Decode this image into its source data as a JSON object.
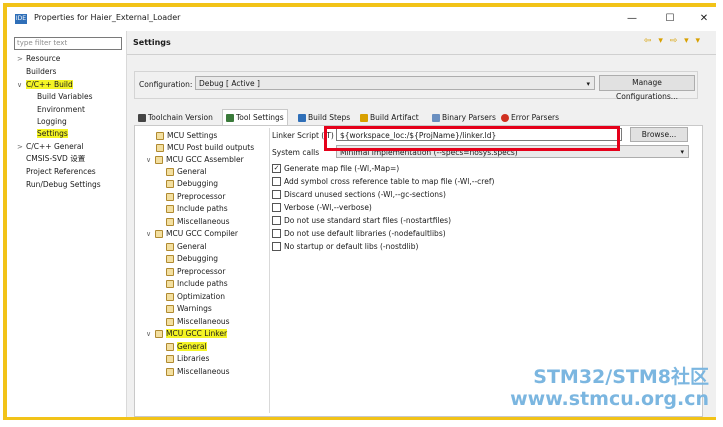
{
  "window": {
    "title": "Properties for Haier_External_Loader",
    "app_icon": "IDE",
    "minimize": "—",
    "maximize": "☐",
    "close": "✕"
  },
  "left": {
    "filter_placeholder": "type filter text",
    "items": [
      {
        "label": "Resource",
        "arrow": ">"
      },
      {
        "label": "Builders",
        "arrow": ""
      },
      {
        "label": "C/C++ Build",
        "arrow": "∨"
      },
      {
        "label": "Build Variables",
        "arrow": ""
      },
      {
        "label": "Environment",
        "arrow": ""
      },
      {
        "label": "Logging",
        "arrow": ""
      },
      {
        "label": "Settings",
        "arrow": ""
      },
      {
        "label": "C/C++ General",
        "arrow": ">"
      },
      {
        "label": "CMSIS-SVD 设置",
        "arrow": ""
      },
      {
        "label": "Project References",
        "arrow": ""
      },
      {
        "label": "Run/Debug Settings",
        "arrow": ""
      }
    ]
  },
  "right": {
    "page_title": "Settings",
    "nav_arrows": "⇦ ▾ ⇨ ▾ ▾",
    "configuration_label": "Configuration:",
    "configuration_value": "Debug  [ Active ]",
    "manage_button": "Manage Configurations...",
    "tabs": [
      {
        "label": "Toolchain Version",
        "icon": "toolchain-icon",
        "color": "#444444"
      },
      {
        "label": "Tool Settings",
        "icon": "tool-settings-icon",
        "color": "#3a7a3a"
      },
      {
        "label": "Build Steps",
        "icon": "build-steps-icon",
        "color": "#2f6fb8"
      },
      {
        "label": "Build Artifact",
        "icon": "build-artifact-icon",
        "color": "#d8a000"
      },
      {
        "label": "Binary Parsers",
        "icon": "binary-parsers-icon",
        "color": "#6a8fc0"
      },
      {
        "label": "Error Parsers",
        "icon": "error-parsers-icon",
        "color": "#d03020"
      }
    ],
    "tool_tree": [
      {
        "label": "MCU Settings"
      },
      {
        "label": "MCU Post build outputs"
      },
      {
        "label": "MCU GCC Assembler",
        "arrow": "∨"
      },
      {
        "label": "General"
      },
      {
        "label": "Debugging"
      },
      {
        "label": "Preprocessor"
      },
      {
        "label": "Include paths"
      },
      {
        "label": "Miscellaneous"
      },
      {
        "label": "MCU GCC Compiler",
        "arrow": "∨"
      },
      {
        "label": "General"
      },
      {
        "label": "Debugging"
      },
      {
        "label": "Preprocessor"
      },
      {
        "label": "Include paths"
      },
      {
        "label": "Optimization"
      },
      {
        "label": "Warnings"
      },
      {
        "label": "Miscellaneous"
      },
      {
        "label": "MCU GCC Linker",
        "arrow": "∨"
      },
      {
        "label": "General"
      },
      {
        "label": "Libraries"
      },
      {
        "label": "Miscellaneous"
      }
    ],
    "linker_script_label": "Linker Script (-T)",
    "linker_script_value": "${workspace_loc:/${ProjName}/linker.ld}",
    "browse_button": "Browse...",
    "system_calls_label": "System calls",
    "system_calls_value": "Minimal implementation (--specs=nosys.specs)",
    "options": [
      {
        "label": "Generate map file (-Wl,-Map=)",
        "checked": true
      },
      {
        "label": "Add symbol cross reference table to map file (-Wl,--cref)",
        "checked": false
      },
      {
        "label": "Discard unused sections (-Wl,--gc-sections)",
        "checked": false
      },
      {
        "label": "Verbose (-Wl,--verbose)",
        "checked": false
      },
      {
        "label": "Do not use standard start files (-nostartfiles)",
        "checked": false
      },
      {
        "label": "Do not use default libraries (-nodefaultlibs)",
        "checked": false
      },
      {
        "label": "No startup or default libs (-nostdlib)",
        "checked": false
      }
    ]
  },
  "watermark": {
    "line1": "STM32/STM8社区",
    "line2": "www.stmcu.org.cn"
  },
  "colors": {
    "frame": "#f2c318",
    "highlight": "#f4f425",
    "annotation": "#e5001a",
    "watermark": "#7bb6e0"
  }
}
